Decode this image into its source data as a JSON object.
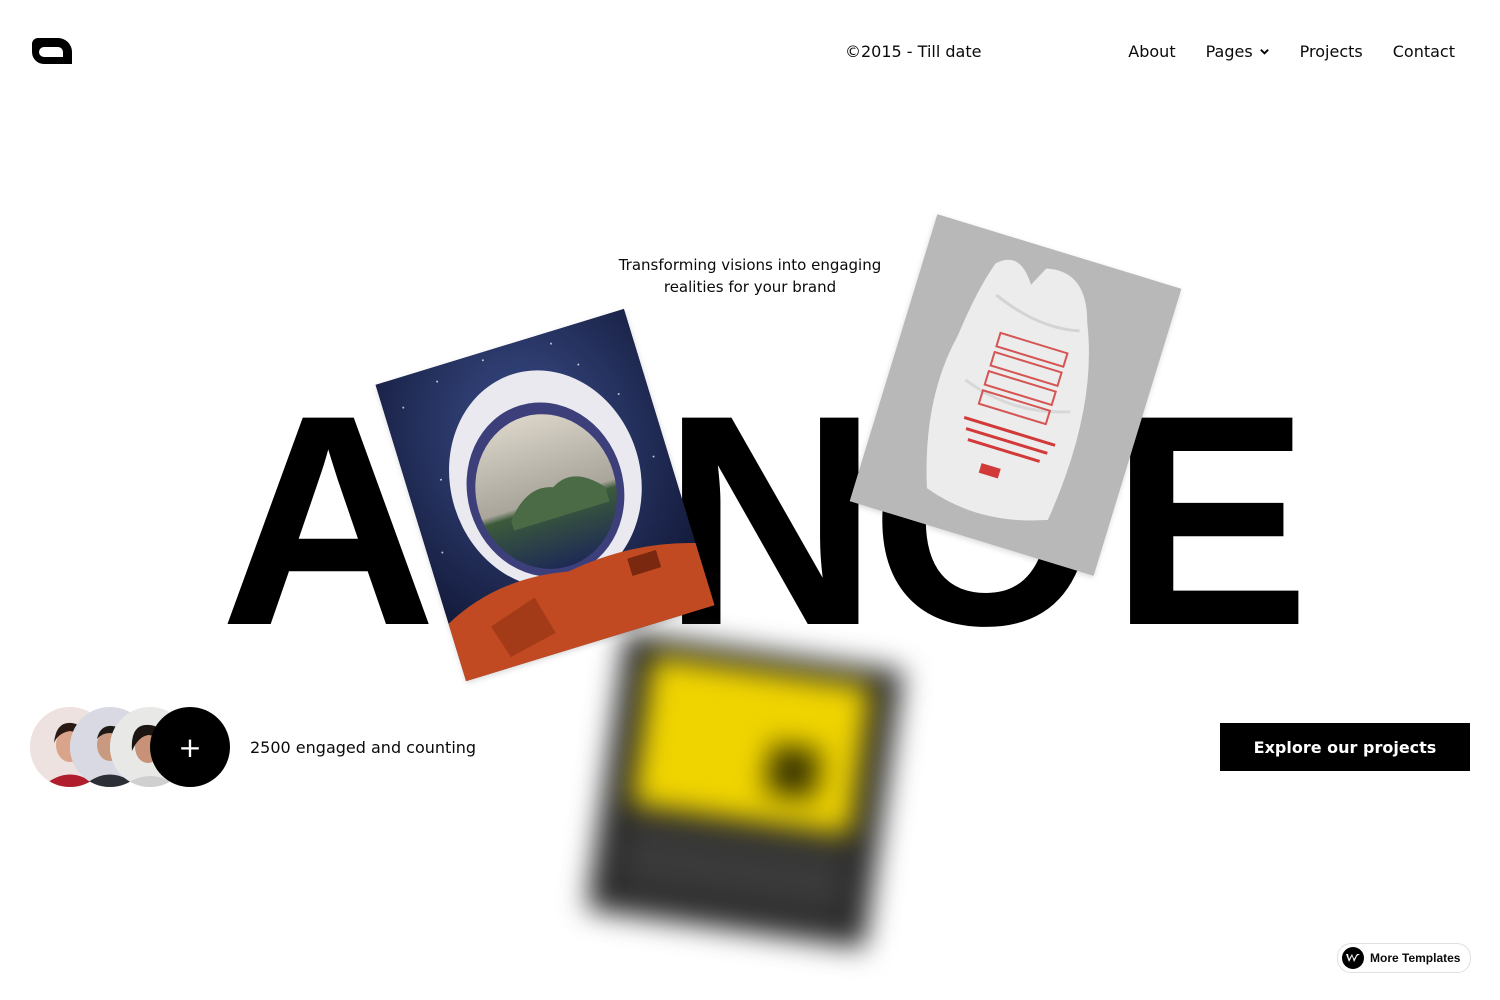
{
  "header": {
    "copyright": "©2015 - Till date",
    "nav": [
      {
        "label": "About"
      },
      {
        "label": "Pages"
      },
      {
        "label": "Projects"
      },
      {
        "label": "Contact"
      }
    ]
  },
  "hero": {
    "tagline_line1": "Transforming visions into engaging",
    "tagline_line2": "realities for your brand",
    "word_letters": [
      "A",
      "N",
      "C",
      "E"
    ]
  },
  "social_proof": {
    "text": "2500 engaged and counting",
    "plus_symbol": "+"
  },
  "cta": {
    "label": "Explore our projects"
  },
  "badge": {
    "label": "More Templates"
  },
  "colors": {
    "text": "#0a0a0a",
    "background": "#ffffff",
    "accent": "#000000"
  }
}
